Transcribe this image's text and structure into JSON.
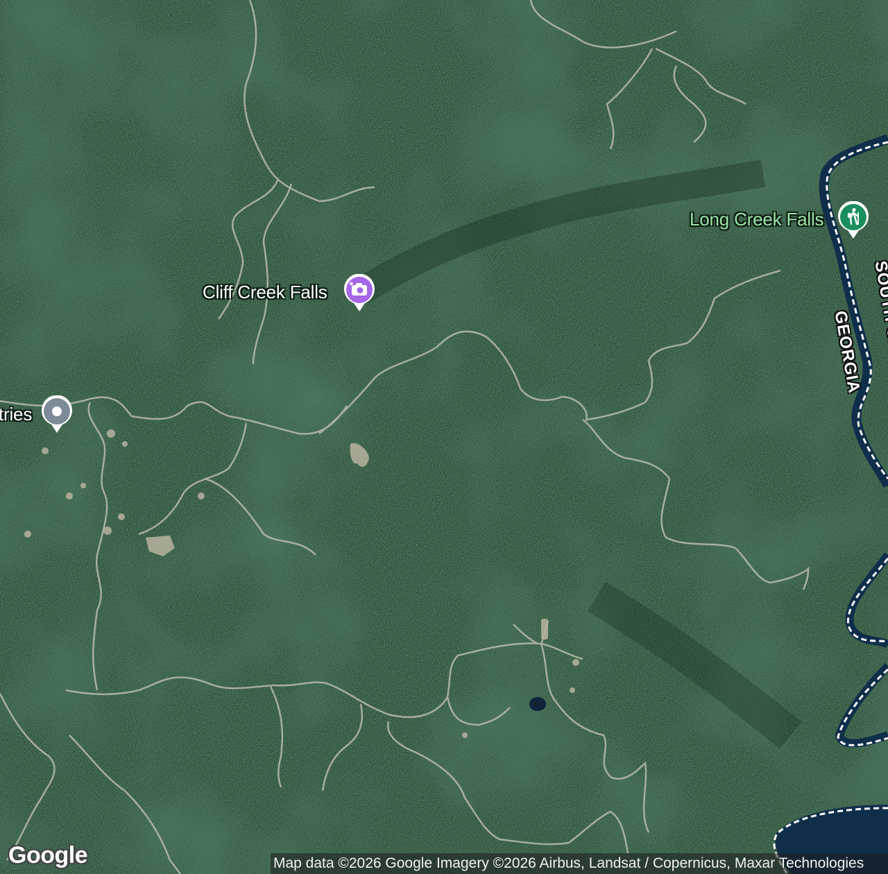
{
  "map": {
    "type": "satellite",
    "pois": [
      {
        "name": "Cliff Creek Falls",
        "category": "scenic viewpoint",
        "icon": "camera-icon",
        "color": "#a566e8"
      },
      {
        "name": "Long Creek Falls",
        "category": "hiking trail",
        "icon": "hiker-icon",
        "color": "#1a8f5e"
      },
      {
        "name": "tries",
        "category": "place",
        "icon": "pin-dot-icon",
        "color": "#7c8b97"
      }
    ],
    "state_labels": [
      "GEORGIA",
      "SOUTH CARO"
    ],
    "logo": "Google",
    "attribution": "Map data ©2026 Google Imagery ©2026 Airbus, Landsat / Copernicus, Maxar Technologies"
  }
}
